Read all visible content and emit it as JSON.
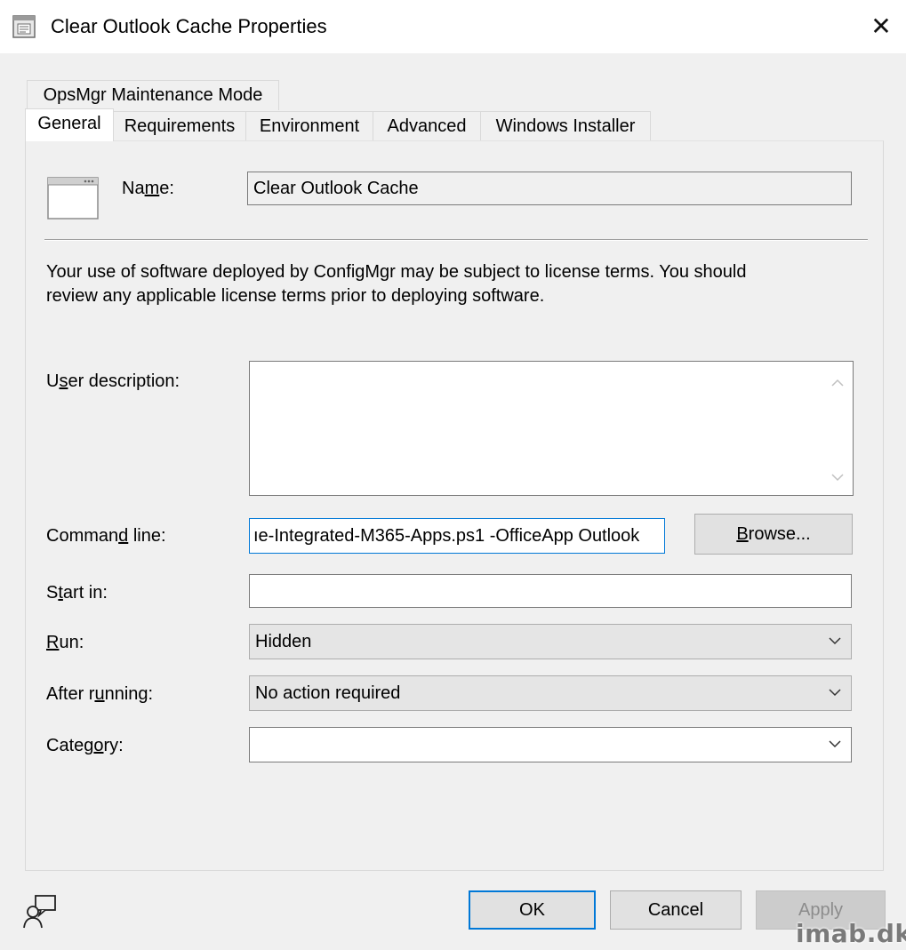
{
  "window": {
    "title": "Clear Outlook Cache Properties",
    "close_label": "✕"
  },
  "tabs": {
    "row1": [
      {
        "label": "OpsMgr Maintenance Mode"
      }
    ],
    "row2": [
      {
        "label": "General",
        "active": true
      },
      {
        "label": "Requirements"
      },
      {
        "label": "Environment"
      },
      {
        "label": "Advanced"
      },
      {
        "label": "Windows Installer"
      }
    ]
  },
  "general": {
    "name_label_pre": "Na",
    "name_label_ul": "m",
    "name_label_post": "e:",
    "name_value": "Clear Outlook Cache",
    "license_line1": "Your use of software deployed by ConfigMgr may be subject to license terms. You should",
    "license_line2": "review any applicable license terms prior to deploying software.",
    "user_description": {
      "label_pre": "U",
      "label_ul": "s",
      "label_post": "er description:",
      "value": ""
    },
    "command_line": {
      "label_pre": "Comman",
      "label_ul": "d",
      "label_post": " line:",
      "value": "ıe-Integrated-M365-Apps.ps1 -OfficeApp Outlook",
      "browse_pre": "",
      "browse_ul": "B",
      "browse_post": "rowse..."
    },
    "start_in": {
      "label_pre": "S",
      "label_ul": "t",
      "label_post": "art in:",
      "value": ""
    },
    "run": {
      "label_pre": "",
      "label_ul": "R",
      "label_post": "un:",
      "value": "Hidden"
    },
    "after_running": {
      "label_pre": "After r",
      "label_ul": "u",
      "label_post": "nning:",
      "value": "No action required"
    },
    "category": {
      "label_pre": "Categ",
      "label_ul": "o",
      "label_post": "ry:",
      "value": ""
    }
  },
  "footer": {
    "ok_label": "OK",
    "cancel_label": "Cancel",
    "apply_label": "Apply",
    "watermark": "imab.dk"
  },
  "icons": {
    "title": "properties-window-icon",
    "program": "program-window-icon",
    "feedback": "feedback-person-icon"
  },
  "colors": {
    "dialog_bg": "#f0f0f0",
    "focus_border": "#0078d7"
  }
}
